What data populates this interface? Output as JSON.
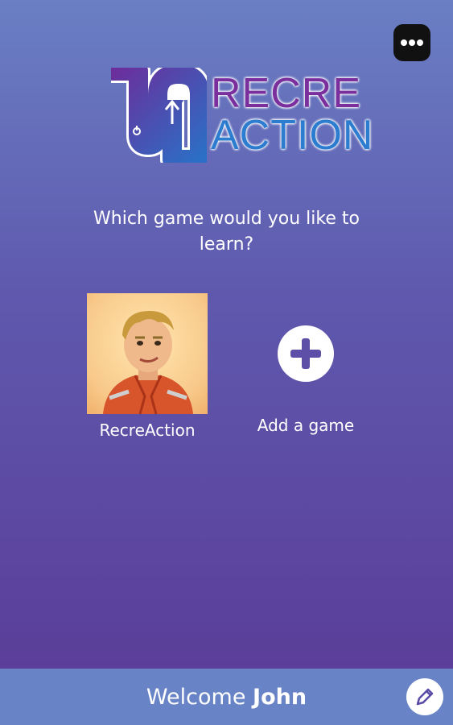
{
  "header": {
    "menu_icon": "more-horizontal-icon"
  },
  "logo": {
    "line1": "RECRE",
    "line2": "ACTION",
    "colors": {
      "purple": "#7a2f9c",
      "blue": "#2c7ccf"
    }
  },
  "main": {
    "question": "Which game would you like to learn?",
    "games": [
      {
        "label": "RecreAction",
        "image": "character-avatar"
      }
    ],
    "add_game": {
      "label": "Add a game",
      "icon": "plus-circle-icon"
    }
  },
  "footer": {
    "welcome_prefix": "Welcome",
    "user_name": "John",
    "edit_icon": "pencil-icon"
  }
}
